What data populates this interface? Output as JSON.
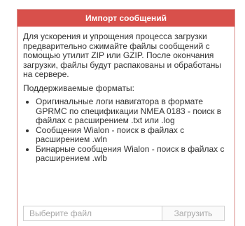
{
  "dialog": {
    "title": "Импорт сообщений",
    "intro": "Для ускорения и упрощения процесса загрузки предварительно сжимайте файлы сообщений с помощью утилит ZIP или GZIP. После окончания загрузки, файлы будут распакованы и обработаны на сервере.",
    "formats_title": "Поддерживаемые форматы:",
    "formats": [
      "Оригинальные логи навигатора в формате GPRMC по спецификации NMEA 0183 - поиск в файлах с расширением .txt или .log",
      "Сообщения Wialon - поиск в файлах с расширением .wln",
      "Бинарные сообщения Wialon - поиск в файлах с расширением .wlb"
    ],
    "file_placeholder": "Выберите файл",
    "upload_label": "Загрузить"
  },
  "colors": {
    "title_bg": "#d8504b",
    "border": "#d98b88",
    "text": "#333333",
    "muted": "#a8a8a8"
  }
}
